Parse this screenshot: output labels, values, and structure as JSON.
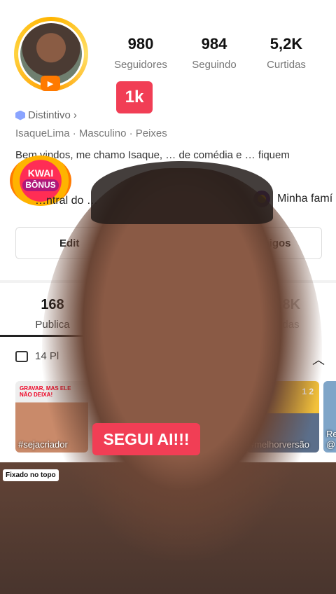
{
  "profile": {
    "stats": [
      {
        "value": "980",
        "label": "Seguidores"
      },
      {
        "value": "984",
        "label": "Seguindo"
      },
      {
        "value": "5,2K",
        "label": "Curtidas"
      }
    ],
    "followers_badge": "1k",
    "distintivo_label": "Distintivo",
    "tags": "IsaqueLima · Masculino · Peixes",
    "bio": "Bem vindos, me chamo Isaque, … de comédia e … fiquem a vont",
    "kwai_bonus": {
      "line1": "KWAI",
      "line2": "BÔNUS"
    },
    "central_label": "…ntral do …",
    "family_label": "Minha famí",
    "edit_button": "Edit",
    "friends_button": "amigos"
  },
  "tabs": [
    {
      "count": "168",
      "label": "Publica"
    },
    {
      "count": "2,8K",
      "label": "…das"
    }
  ],
  "playlist": {
    "label": "14 Pl"
  },
  "thumbnails": [
    {
      "caption": "#sejacriador",
      "overlay": "GRAVAR, MAS ELE NÃO DEIXA!"
    },
    {
      "caption": "#melhorversão",
      "overlay": "1   2"
    },
    {
      "caption": "Re @"
    }
  ],
  "pinned_label": "Fixado no topo",
  "overlay_caption": "SEGUI AI!!!",
  "colors": {
    "accent": "#f13e55",
    "gold": "#ffb400"
  }
}
